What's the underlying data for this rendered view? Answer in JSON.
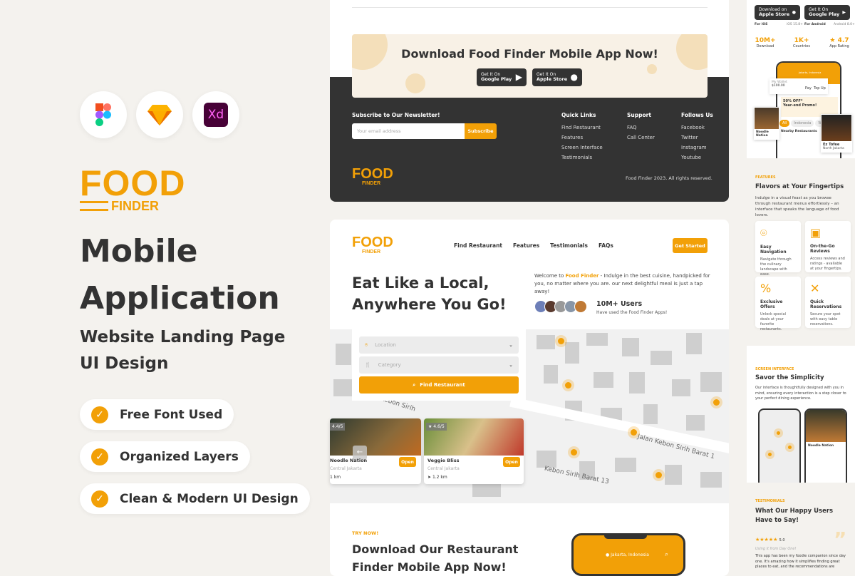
{
  "colors": {
    "accent": "#f2a007",
    "dark": "#333333",
    "bg": "#f4f2ee"
  },
  "tools": [
    {
      "icon": "figma-icon"
    },
    {
      "icon": "sketch-icon"
    },
    {
      "icon": "adobe-xd-icon",
      "label": "Xd"
    }
  ],
  "logo": {
    "top": "FOOD",
    "bottom": "FINDER"
  },
  "hero": {
    "title1": "Mobile",
    "title2": "Application",
    "subtitle": "Website Landing Page UI Design"
  },
  "features": [
    "Free Font Used",
    "Organized Layers",
    "Clean & Modern UI Design"
  ],
  "footer_card": {
    "banner_title": "Download Food Finder Mobile App Now!",
    "google": {
      "top": "Get It On",
      "name": "Google Play"
    },
    "apple": {
      "top": "Get It On",
      "name": "Apple Store"
    },
    "newsletter_label": "Subscribe to Our Newsletter!",
    "email_placeholder": "Your email address",
    "subscribe": "Subscribe",
    "columns": [
      {
        "title": "Quick Links",
        "links": [
          "Find Restaurant",
          "Features",
          "Screen Interface",
          "Testimonials"
        ]
      },
      {
        "title": "Support",
        "links": [
          "FAQ",
          "Call Center"
        ]
      },
      {
        "title": "Follows Us",
        "links": [
          "Facebook",
          "Twitter",
          "Instagram",
          "Youtube"
        ]
      }
    ],
    "copyright": "Food Finder 2023. All rights reserved."
  },
  "landing": {
    "nav": [
      "Find Restaurant",
      "Features",
      "Testimonials",
      "FAQs"
    ],
    "cta": "Get Started",
    "headline1": "Eat Like a Local,",
    "headline2": "Anywhere You Go!",
    "welcome_pre": "Welcome to ",
    "brand": "Food Finder",
    "welcome_post": " - Indulge in the best cuisine, handpicked for you, no matter where you are. our next delightful meal is just a tap away!",
    "users_count": "10M+ Users",
    "users_sub": "Have used the Food Finder Apps!",
    "location_placeholder": "Location",
    "category_placeholder": "Category",
    "find": "Find Restaurant",
    "streets": [
      "Kebon Sirih",
      "Jalan Kebon Sirih Barat 1",
      "Kebon Sirih Barat 13",
      "Kebon Sirih Barat 1"
    ],
    "restaurants": [
      {
        "rating": "4.4/5",
        "name": "Noodle Nation",
        "area": "Central Jakarta",
        "distance": "1 km",
        "status": "Open"
      },
      {
        "rating": "4.6/5",
        "name": "Veggie Bliss",
        "area": "Central Jakarta",
        "distance": "1.2 km",
        "status": "Open"
      }
    ],
    "try_label": "TRY NOW!",
    "try_title1": "Download Our Restaurant",
    "try_title2": "Finder Mobile App Now!",
    "phone_location": "Jakarta, Indonesia"
  },
  "right": {
    "apple": {
      "top": "Download on",
      "name": "Apple Store",
      "platform": "For iOS",
      "version": "iOS 15.8+"
    },
    "google": {
      "top": "Get It On",
      "name": "Google Play",
      "platform": "For Android",
      "version": "Android 8.0+"
    },
    "stats": [
      {
        "value": "10M+",
        "label": "Download"
      },
      {
        "value": "1K+",
        "label": "Countries"
      },
      {
        "value": "4.7",
        "label": "App Rating"
      }
    ],
    "phone": {
      "location": "Jakarta, Indonesia",
      "wallet_label": "My Wallet",
      "wallet": "$100.00",
      "pay": "Pay",
      "topup": "Top Up",
      "promo1": "50% OFF*",
      "promo2": "Year-end Promo!",
      "tabs": [
        "All",
        "Indonesia",
        "Western"
      ],
      "nearby": "Nearby Restaurants",
      "card1": "Noodle Nation",
      "card2": "Ez Tofee",
      "card2_loc": "North Jakarta"
    },
    "features_label": "FEATURES",
    "features_title": "Flavors at Your Fingertips",
    "features_desc": "Indulge in a visual feast as you browse through restaurant menus effortlessly – an interface that speaks the language of food lovers.",
    "feature_cards": [
      {
        "icon": "location-pin-icon",
        "title": "Easy Navigation",
        "desc": "Navigate through the culinary landscape with ease."
      },
      {
        "icon": "review-chat-icon",
        "title": "On-the-Go Reviews",
        "desc": "Access reviews and ratings - available at your fingertips."
      },
      {
        "icon": "percent-icon",
        "title": "Exclusive Offers",
        "desc": "Unlock special deals at your favorite restaurants."
      },
      {
        "icon": "utensils-icon",
        "title": "Quick Reservations",
        "desc": "Secure your spot with easy table reservations."
      }
    ],
    "screen_label": "SCREEN INTERFACE",
    "screen_title": "Savor the Simplicity",
    "screen_desc": "Our interface is thoughtfully designed with you in mind, ensuring every interaction is a step closer to your perfect dining experience.",
    "screen_phone_title": "Noodle Nation",
    "testi_label": "TESTIMONIALS",
    "testi_title": "What Our Happy Users Have to Say!",
    "testi_rating": "5.0",
    "testi_headline": "Using it from Day One!",
    "testi_text": "This app has been my foodie companion since day one. It's amazing how it simplifies finding great places to eat, and the recommendations are"
  }
}
